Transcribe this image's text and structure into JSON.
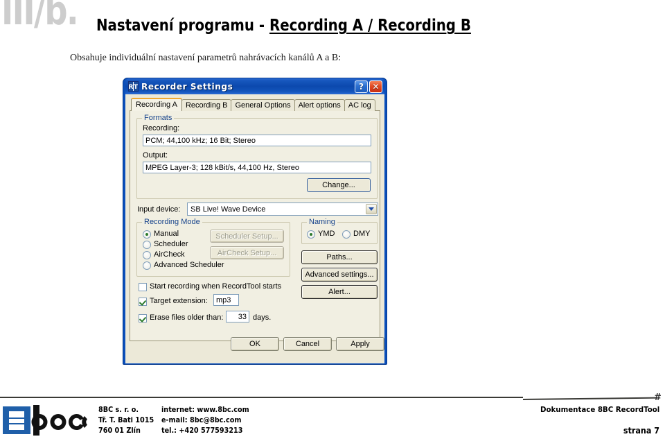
{
  "header": {
    "chapter_mark": "III/b.",
    "title_prefix": "Nastavení programu - ",
    "title_underlined": "Recording A / Recording B",
    "subtitle": "Obsahuje individuální nastavení parametrů nahrávacích kanálů A a B:"
  },
  "dialog": {
    "title": "Recorder Settings",
    "icon_label": "RT",
    "help_glyph": "?",
    "close_glyph": "✕",
    "tabs": [
      {
        "label": "Recording A",
        "active": true
      },
      {
        "label": "Recording B",
        "active": false
      },
      {
        "label": "General Options",
        "active": false
      },
      {
        "label": "Alert options",
        "active": false
      },
      {
        "label": "AC log",
        "active": false
      }
    ],
    "formats": {
      "group_title": "Formats",
      "recording_label": "Recording:",
      "recording_value": "PCM; 44,100 kHz; 16 Bit; Stereo",
      "output_label": "Output:",
      "output_value": "MPEG Layer-3; 128 kBit/s, 44,100 Hz, Stereo",
      "change_button": "Change..."
    },
    "input_device": {
      "label": "Input device:",
      "value": "SB Live! Wave Device"
    },
    "recording_mode": {
      "group_title": "Recording Mode",
      "options": [
        {
          "label": "Manual",
          "selected": true
        },
        {
          "label": "Scheduler",
          "selected": false
        },
        {
          "label": "AirCheck",
          "selected": false
        },
        {
          "label": "Advanced Scheduler",
          "selected": false
        }
      ],
      "scheduler_setup_button": "Scheduler Setup...",
      "aircheck_setup_button": "AirCheck Setup..."
    },
    "naming": {
      "group_title": "Naming",
      "options": [
        {
          "label": "YMD",
          "selected": true
        },
        {
          "label": "DMY",
          "selected": false
        }
      ]
    },
    "side_buttons": {
      "paths": "Paths...",
      "advanced_settings": "Advanced settings...",
      "alert": "Alert..."
    },
    "checkboxes": {
      "startup_label": "Start recording when RecordTool starts",
      "startup_checked": false,
      "target_ext_label": "Target extension:",
      "target_ext_checked": true,
      "target_ext_value": "mp3",
      "erase_label": "Erase files older than:",
      "erase_checked": true,
      "erase_days_value": "33",
      "erase_suffix": "days."
    },
    "footer_buttons": {
      "ok": "OK",
      "cancel": "Cancel",
      "apply": "Apply"
    }
  },
  "footer": {
    "hash": "#",
    "company": "8BC s. r. o.",
    "street": "Tř. T. Bati 1015",
    "city": "760 01  Zlín",
    "internet": "internet: www.8bc.com",
    "email": "e-mail: 8bc@8bc.com",
    "phone": "tel.: +420 577593213",
    "doc_label": "Dokumentace 8BC RecordTool",
    "page_number": "strana 7"
  },
  "colors": {
    "title_bar": "#0c49ae",
    "dialog_face": "#ece9d8",
    "tab_panel": "#f1efe2",
    "group_title": "#15428b",
    "active_tab_accent": "#f0a830",
    "check_green": "#2b7a2b",
    "logo_blue": "#1f5fa9",
    "watermark_gray": "#cdcdcd"
  }
}
